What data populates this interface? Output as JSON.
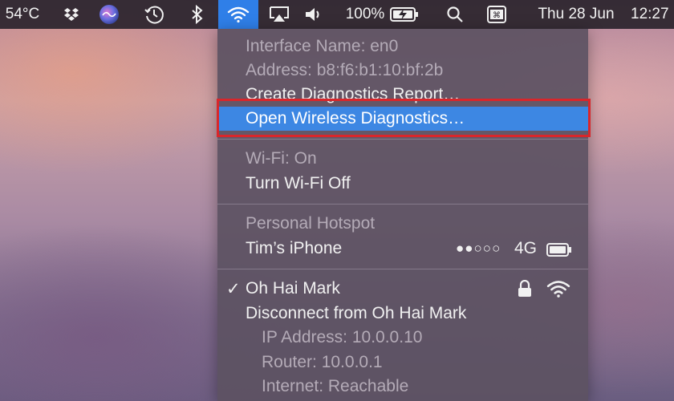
{
  "menubar": {
    "temperature": "54°C",
    "battery_percent": "100%",
    "date": "Thu 28 Jun",
    "time": "12:27",
    "icons": [
      "dropbox-icon",
      "siri-icon",
      "time-machine-icon",
      "bluetooth-icon",
      "wifi-icon",
      "airplay-icon",
      "volume-icon",
      "battery-charging-icon",
      "spotlight-icon",
      "control-strip-icon"
    ]
  },
  "wifi_menu": {
    "interface_name": "Interface Name: en0",
    "address": "Address: b8:f6:b1:10:bf:2b",
    "create_report": "Create Diagnostics Report…",
    "open_diagnostics": "Open Wireless Diagnostics…",
    "wifi_status": "Wi-Fi: On",
    "turn_off": "Turn Wi-Fi Off",
    "hotspot_header": "Personal Hotspot",
    "hotspot_device": "Tim’s iPhone",
    "hotspot_signal": "●●○○○",
    "hotspot_network": "4G",
    "current_check": "✓",
    "current_network": "Oh Hai Mark",
    "disconnect": "Disconnect from Oh Hai Mark",
    "ip_address": "IP Address: 10.0.0.10",
    "router": "Router: 10.0.0.1",
    "internet": "Internet: Reachable"
  },
  "colors": {
    "highlight": "#3d87e3",
    "callout_border": "#d9262b",
    "menubar_active": "#2f7fe8"
  }
}
